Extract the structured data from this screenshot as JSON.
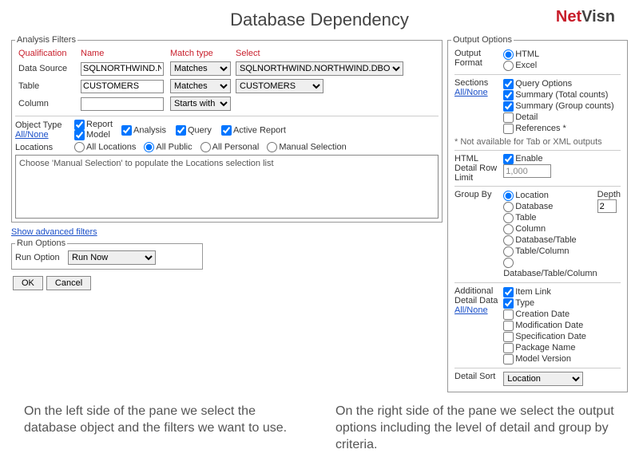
{
  "title": "Database Dependency",
  "logo": {
    "part1": "Net",
    "part2": "Visn"
  },
  "analysis_filters": {
    "legend": "Analysis Filters",
    "headers": {
      "qualification": "Qualification",
      "name": "Name",
      "match_type": "Match type",
      "select": "Select"
    },
    "rows": {
      "data_source": {
        "label": "Data Source",
        "name_value": "SQLNORTHWIND.NO",
        "match": "Matches",
        "select": "SQLNORTHWIND.NORTHWIND.DBO"
      },
      "table": {
        "label": "Table",
        "name_value": "CUSTOMERS",
        "match": "Matches",
        "select": "CUSTOMERS"
      },
      "column": {
        "label": "Column",
        "name_value": "",
        "match": "Starts with"
      }
    },
    "object_type": {
      "label": "Object Type",
      "link": "All/None",
      "options": {
        "report": "Report",
        "model": "Model",
        "analysis": "Analysis",
        "query": "Query",
        "active_report": "Active Report"
      }
    },
    "locations": {
      "label": "Locations",
      "options": {
        "all_locations": "All Locations",
        "all_public": "All Public",
        "all_personal": "All Personal",
        "manual": "Manual Selection"
      }
    },
    "locations_hint": "Choose 'Manual Selection' to populate the Locations selection list",
    "advanced_link": "Show advanced filters"
  },
  "run_options": {
    "legend": "Run Options",
    "label": "Run Option",
    "value": "Run Now"
  },
  "buttons": {
    "ok": "OK",
    "cancel": "Cancel"
  },
  "output_options": {
    "legend": "Output Options",
    "output_format": {
      "label": "Output Format",
      "html": "HTML",
      "excel": "Excel"
    },
    "sections": {
      "label": "Sections",
      "link": "All/None",
      "query_options": "Query Options",
      "summary_total": "Summary (Total counts)",
      "summary_group": "Summary (Group counts)",
      "detail": "Detail",
      "references": "References *"
    },
    "note": "* Not available for Tab or XML outputs",
    "row_limit": {
      "label": "HTML Detail Row Limit",
      "enable": "Enable",
      "value": "1,000"
    },
    "group_by": {
      "label": "Group By",
      "location": "Location",
      "database": "Database",
      "table": "Table",
      "column": "Column",
      "db_table": "Database/Table",
      "table_column": "Table/Column",
      "db_table_column": "Database/Table/Column",
      "depth_label": "Depth",
      "depth_value": "2"
    },
    "additional": {
      "label1": "Additional",
      "label2": "Detail Data",
      "link": "All/None",
      "item_link": "Item Link",
      "type": "Type",
      "creation_date": "Creation Date",
      "modification_date": "Modification Date",
      "specification_date": "Specification Date",
      "package_name": "Package Name",
      "model_version": "Model Version"
    },
    "detail_sort": {
      "label": "Detail Sort",
      "value": "Location"
    }
  },
  "captions": {
    "left": "On the left side of the pane we select the database object and the filters we want to use.",
    "right": "On the right side of the pane we select the output options including the level of detail and group by criteria."
  }
}
